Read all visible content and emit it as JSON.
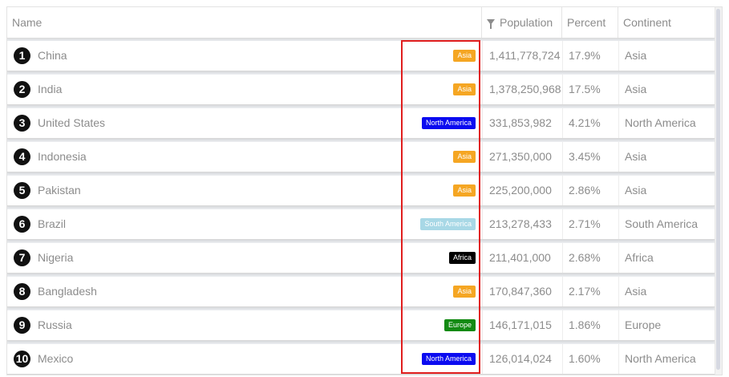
{
  "columns": {
    "name": "Name",
    "population": "Population",
    "percent": "Percent",
    "continent": "Continent"
  },
  "header_icons": {
    "population_filter": "filter-icon"
  },
  "continent_colors": {
    "Asia": "#f5a623",
    "North America": "#0b0bf0",
    "South America": "#a8d8e6",
    "Africa": "#000000",
    "Europe": "#138a13"
  },
  "rows": [
    {
      "rank": "1",
      "name": "China",
      "badge": "Asia",
      "population": "1,411,778,724",
      "percent": "17.9%",
      "continent": "Asia"
    },
    {
      "rank": "2",
      "name": "India",
      "badge": "Asia",
      "population": "1,378,250,968",
      "percent": "17.5%",
      "continent": "Asia"
    },
    {
      "rank": "3",
      "name": "United States",
      "badge": "North America",
      "population": "331,853,982",
      "percent": "4.21%",
      "continent": "North America"
    },
    {
      "rank": "4",
      "name": "Indonesia",
      "badge": "Asia",
      "population": "271,350,000",
      "percent": "3.45%",
      "continent": "Asia"
    },
    {
      "rank": "5",
      "name": "Pakistan",
      "badge": "Asia",
      "population": "225,200,000",
      "percent": "2.86%",
      "continent": "Asia"
    },
    {
      "rank": "6",
      "name": "Brazil",
      "badge": "South America",
      "population": "213,278,433",
      "percent": "2.71%",
      "continent": "South America"
    },
    {
      "rank": "7",
      "name": "Nigeria",
      "badge": "Africa",
      "population": "211,401,000",
      "percent": "2.68%",
      "continent": "Africa"
    },
    {
      "rank": "8",
      "name": "Bangladesh",
      "badge": "Asia",
      "population": "170,847,360",
      "percent": "2.17%",
      "continent": "Asia"
    },
    {
      "rank": "9",
      "name": "Russia",
      "badge": "Europe",
      "population": "146,171,015",
      "percent": "1.86%",
      "continent": "Europe"
    },
    {
      "rank": "10",
      "name": "Mexico",
      "badge": "North America",
      "population": "126,014,024",
      "percent": "1.60%",
      "continent": "North America"
    }
  ]
}
